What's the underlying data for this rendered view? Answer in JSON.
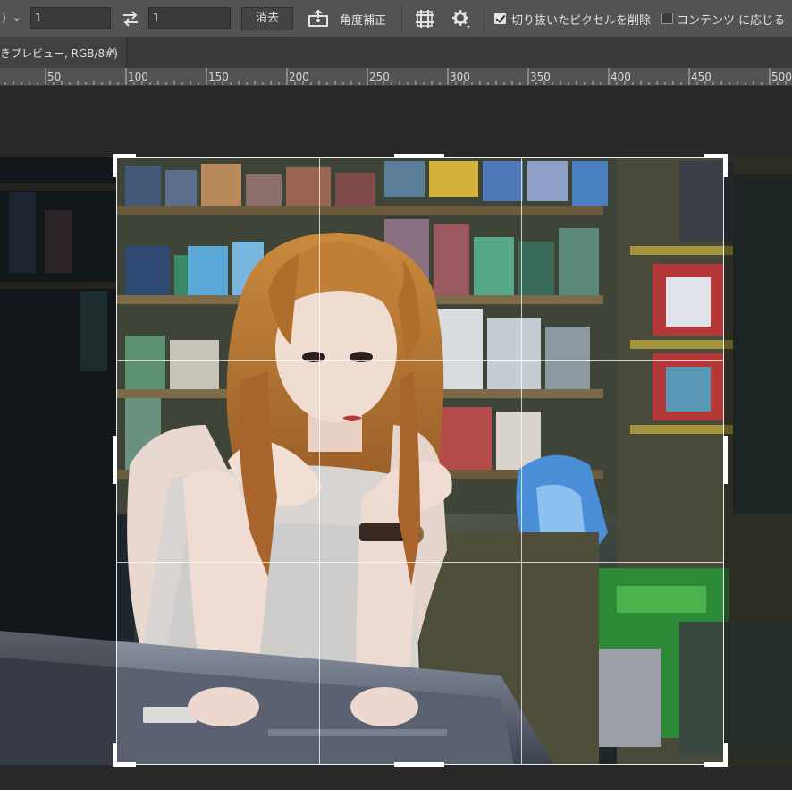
{
  "options_bar": {
    "ratio_dropdown": ")",
    "width_value": "1",
    "height_value": "1",
    "swap_icon": "swap-arrows-icon",
    "clear_label": "消去",
    "straighten_label": "角度補正",
    "grid_overlay_icon": "grid-overlay-icon",
    "settings_icon": "gear-icon",
    "delete_cropped_pixels": {
      "label": "切り抜いたピクセルを削除",
      "checked": true
    },
    "content_aware": {
      "label": "コンテンツ に応じる",
      "checked": false
    }
  },
  "document_tab": {
    "title": "きプレビュー, RGB/8#)",
    "close_icon": "×"
  },
  "ruler": {
    "labels": [
      "50",
      "100",
      "150",
      "200",
      "250",
      "300",
      "350",
      "400",
      "450",
      "500"
    ]
  },
  "crop": {
    "grid": "rule-of-thirds"
  }
}
